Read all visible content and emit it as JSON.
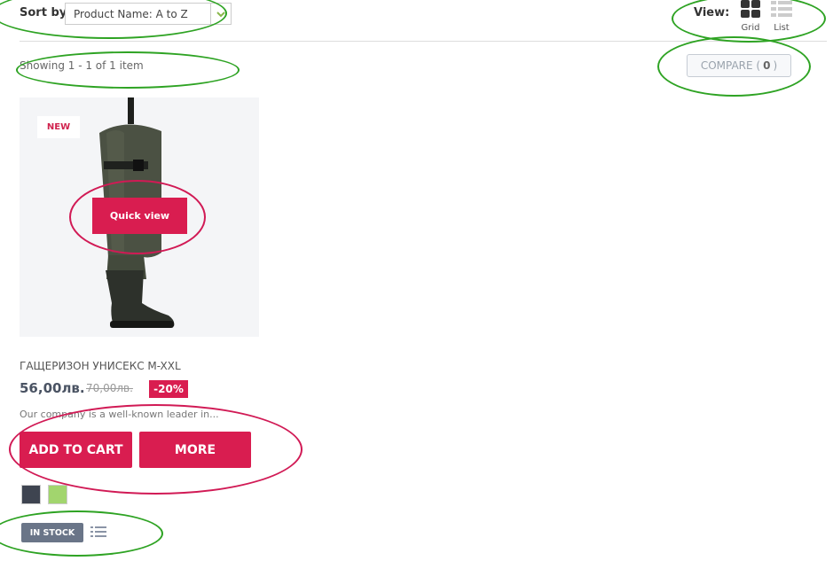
{
  "toolbar": {
    "sort_label": "Sort by",
    "sort_value": "Product Name: A to Z",
    "view_label": "View:",
    "grid_label": "Grid",
    "list_label": "List",
    "showing": "Showing 1 - 1 of 1 item",
    "compare_label": "COMPARE (",
    "compare_count": "0",
    "compare_close": ")"
  },
  "product": {
    "badge": "NEW",
    "quick_view": "Quick view",
    "name": "ГАЩЕРИЗОН УНИСЕКС M-XXL",
    "price": "56,00лв.",
    "old_price": "70,00лв.",
    "discount": "-20%",
    "description": "Our company is a well-known leader in...",
    "add_to_cart": "ADD TO CART",
    "more": "MORE",
    "colors": [
      "#3e4450",
      "#a2d56e"
    ],
    "stock": "IN STOCK"
  },
  "colors": {
    "accent": "#d91d50",
    "annotation_green": "#2ea323",
    "annotation_pink": "#d11a55"
  }
}
